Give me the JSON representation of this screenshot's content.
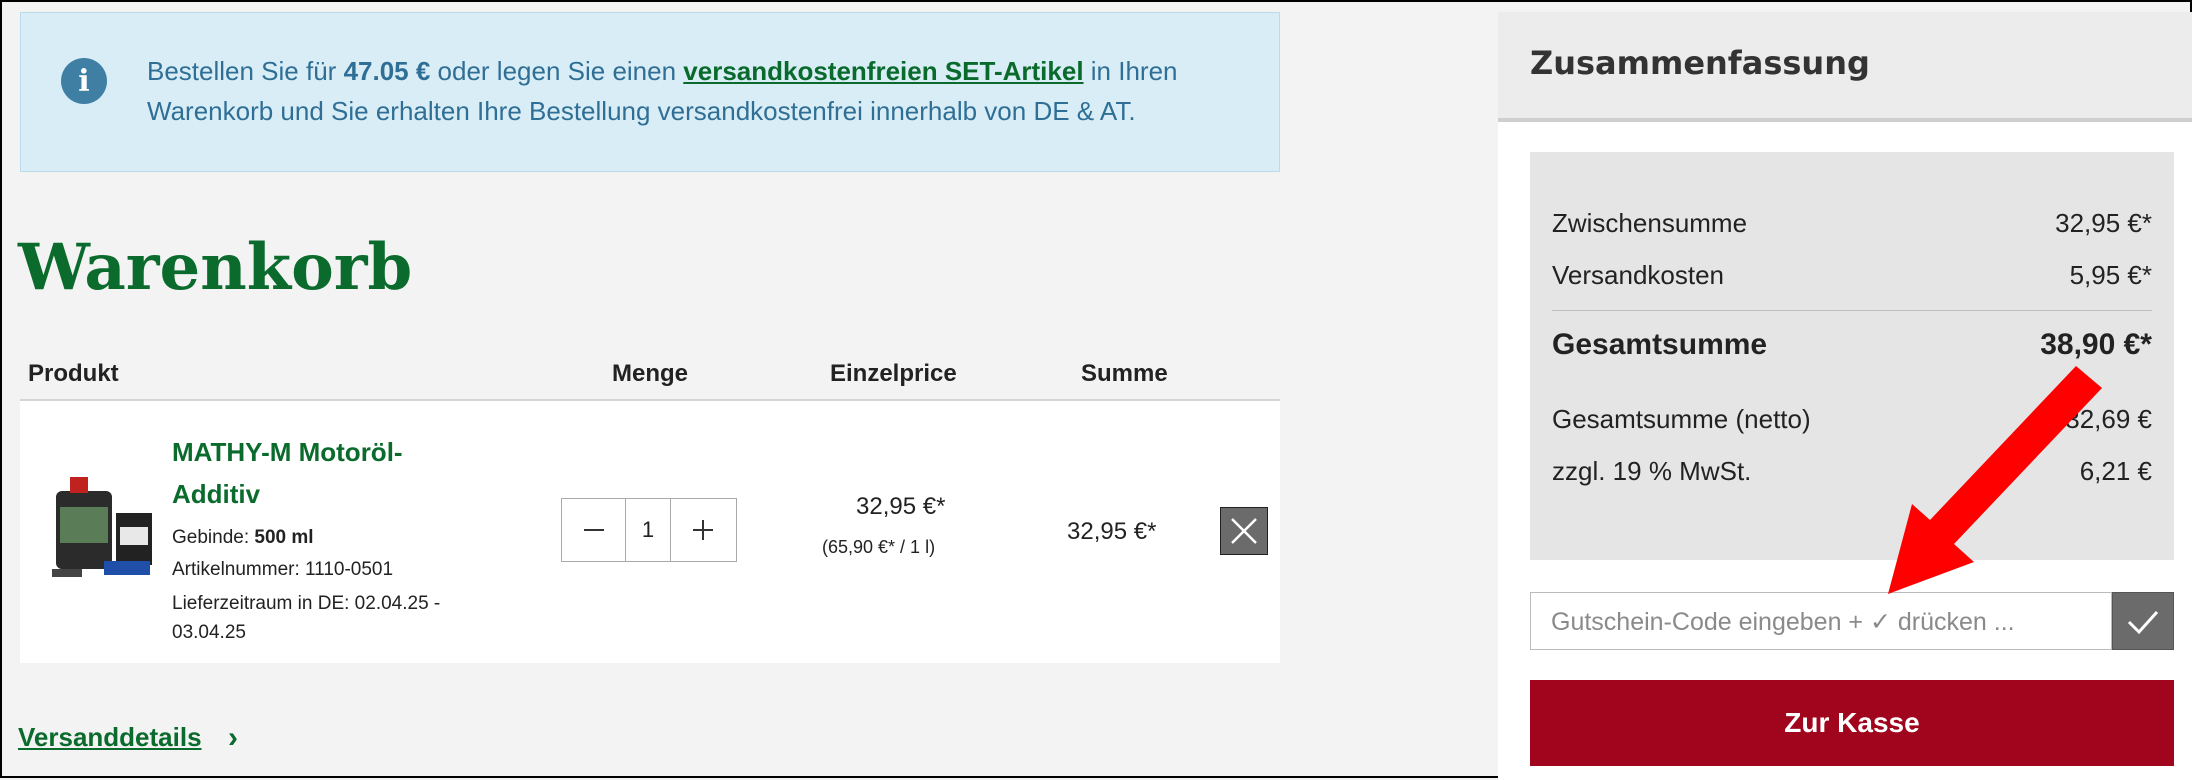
{
  "banner": {
    "text_prefix": "Bestellen Sie für ",
    "amount": "47.05 €",
    "text_middle": " oder legen Sie einen ",
    "link": "versandkostenfreien SET-Artikel",
    "text_suffix": " in Ihren Warenkorb und Sie erhalten Ihre Bestellung versandkostenfrei innerhalb von DE & AT."
  },
  "cart": {
    "title": "Warenkorb",
    "headers": {
      "product": "Produkt",
      "quantity": "Menge",
      "unit_price": "Einzelprice",
      "sum": "Summe"
    },
    "item": {
      "name": "MATHY-M Motoröl-Additiv",
      "package_label": "Gebinde:",
      "package_value": "500 ml",
      "article_number": "Artikelnummer: 1110-0501",
      "delivery": "Lieferzeitraum in DE: 02.04.25 - 03.04.25",
      "quantity": "1",
      "unit_price": "32,95 €*",
      "base_price": "(65,90 €* / 1 l)",
      "sum": "32,95 €*"
    },
    "shipping_link": "Versanddetails"
  },
  "summary": {
    "title": "Zusammenfassung",
    "subtotal_label": "Zwischensumme",
    "subtotal": "32,95 €*",
    "shipping_label": "Versandkosten",
    "shipping": "5,95 €*",
    "total_label": "Gesamtsumme",
    "total": "38,90 €*",
    "net_label": "Gesamtsumme (netto)",
    "net": "32,69 €",
    "vat_label": "zzgl. 19 % MwSt.",
    "vat": "6,21 €",
    "coupon_placeholder": "Gutschein-Code eingeben + ✓ drücken ...",
    "checkout": "Zur Kasse"
  },
  "colors": {
    "green": "#0b6b2d",
    "checkout": "#a1051d",
    "arrow": "#ff0000",
    "info_bg": "#d9edf7"
  }
}
